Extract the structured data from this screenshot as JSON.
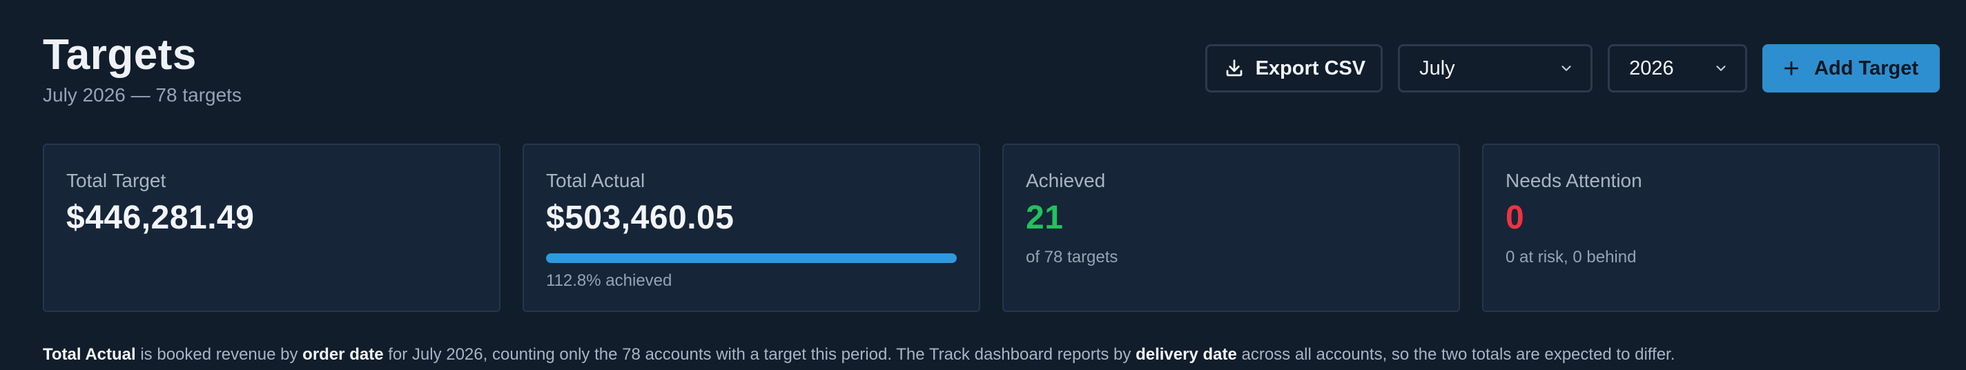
{
  "header": {
    "title": "Targets",
    "subtitle": "July 2026 — 78 targets"
  },
  "toolbar": {
    "export_label": "Export CSV",
    "export_icon": "download-icon",
    "month_value": "July",
    "year_value": "2026",
    "add_label": "Add Target",
    "add_icon": "plus-icon"
  },
  "cards": {
    "total_target": {
      "label": "Total Target",
      "value": "$446,281.49"
    },
    "total_actual": {
      "label": "Total Actual",
      "value": "$503,460.05",
      "progress_percent": 100,
      "note": "112.8% achieved"
    },
    "achieved": {
      "label": "Achieved",
      "value": "21",
      "note": "of 78 targets"
    },
    "needs_attention": {
      "label": "Needs Attention",
      "value": "0",
      "note": "0 at risk, 0 behind"
    }
  },
  "footnote": {
    "b1": "Total Actual",
    "t1": " is booked revenue by ",
    "b2": "order date",
    "t2": " for July 2026, counting only the 78 accounts with a target this period. The Track dashboard reports by ",
    "b3": "delivery date",
    "t3": " across all accounts, so the two totals are expected to differ."
  },
  "colors": {
    "background": "#111d2b",
    "card": "#172538",
    "accent": "#2d8fd0",
    "success": "#21c25e",
    "danger": "#ef3340"
  }
}
